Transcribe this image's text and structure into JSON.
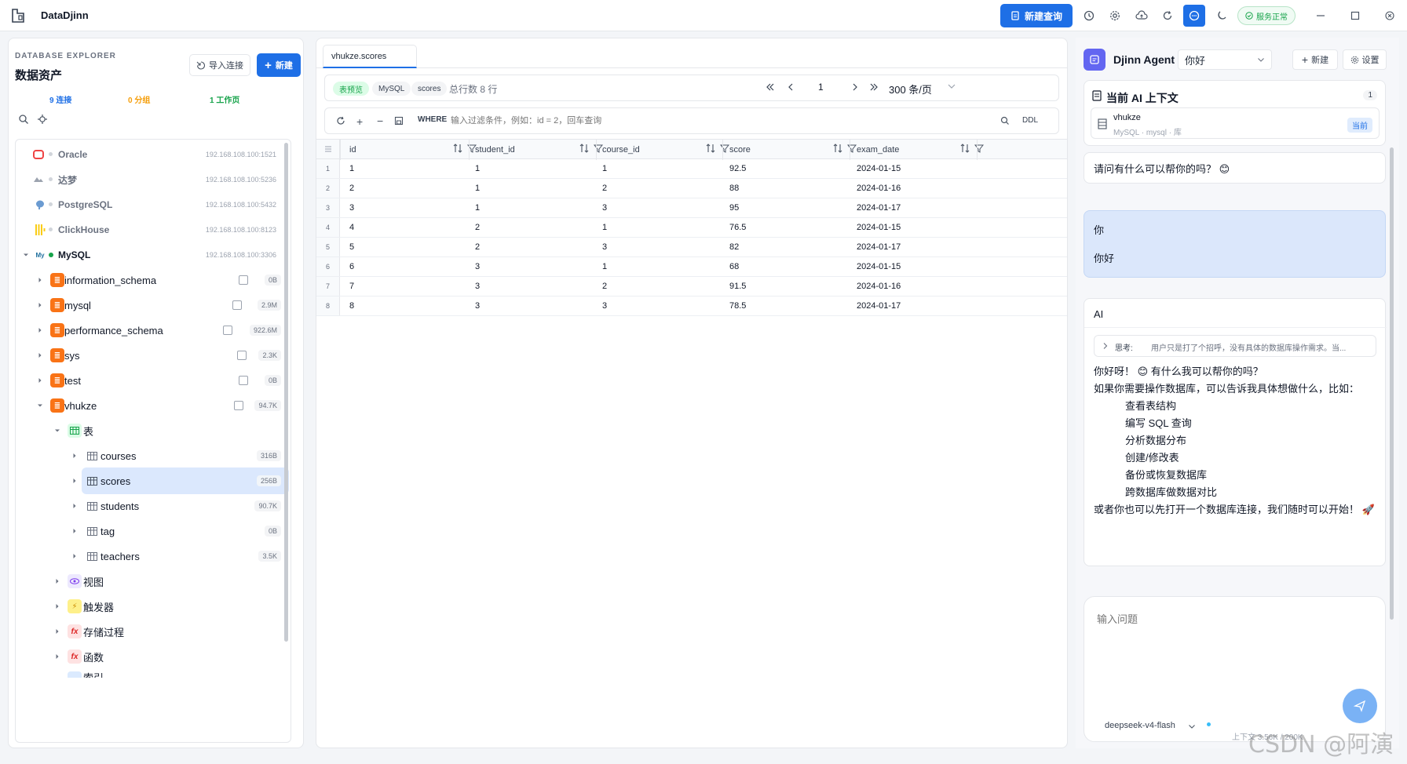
{
  "app": {
    "title": "DataDjinn"
  },
  "titlebar": {
    "new_query": "新建查询",
    "status": "服务正常"
  },
  "colors": {
    "accent": "#1e6fe6",
    "green": "#16a34a",
    "orange": "#f59e0b",
    "purple": "#6366f1"
  },
  "explorer": {
    "subtitle": "DATABASE EXPLORER",
    "title": "数据资产",
    "import_label": "导入连接",
    "new_label": "新建",
    "stats": {
      "connections": "9 连接",
      "groups": "0 分组",
      "workspaces": "1 工作页"
    }
  },
  "tree": {
    "connections": [
      {
        "name": "Oracle",
        "host": "192.168.108.100:1521",
        "icon": "oracle-icon"
      },
      {
        "name": "达梦",
        "host": "192.168.108.100:5236",
        "icon": "dameng-icon"
      },
      {
        "name": "PostgreSQL",
        "host": "192.168.108.100:5432",
        "icon": "postgresql-icon"
      },
      {
        "name": "ClickHouse",
        "host": "192.168.108.100:8123",
        "icon": "clickhouse-icon"
      },
      {
        "name": "MySQL",
        "host": "192.168.108.100:3306",
        "icon": "mysql-icon"
      }
    ],
    "databases": [
      {
        "name": "information_schema",
        "size": "0B"
      },
      {
        "name": "mysql",
        "size": "2.9M"
      },
      {
        "name": "performance_schema",
        "size": "922.6M"
      },
      {
        "name": "sys",
        "size": "2.3K"
      },
      {
        "name": "test",
        "size": "0B"
      },
      {
        "name": "vhukze",
        "size": "94.7K"
      }
    ],
    "tables_group": "表",
    "tables": [
      {
        "name": "courses",
        "size": "316B"
      },
      {
        "name": "scores",
        "size": "256B"
      },
      {
        "name": "students",
        "size": "90.7K"
      },
      {
        "name": "tag",
        "size": "0B"
      },
      {
        "name": "teachers",
        "size": "3.5K"
      }
    ],
    "groups": [
      "视图",
      "触发器",
      "存储过程",
      "函数"
    ],
    "cut_off": "索引"
  },
  "editor": {
    "tab": "vhukze.scores",
    "chips": [
      "表预览",
      "MySQL",
      "scores"
    ],
    "total": "总行数 8 行",
    "page": "1",
    "page_size": "300 条/页",
    "where_label": "WHERE",
    "where_placeholder": "输入过滤条件，例如：id = 2，回车查询",
    "ddl": "DDL",
    "columns": [
      "id",
      "student_id",
      "course_id",
      "score",
      "exam_date"
    ],
    "rows": [
      [
        "1",
        "1",
        "1",
        "92.5",
        "2024-01-15"
      ],
      [
        "2",
        "1",
        "2",
        "88",
        "2024-01-16"
      ],
      [
        "3",
        "1",
        "3",
        "95",
        "2024-01-17"
      ],
      [
        "4",
        "2",
        "1",
        "76.5",
        "2024-01-15"
      ],
      [
        "5",
        "2",
        "3",
        "82",
        "2024-01-17"
      ],
      [
        "6",
        "3",
        "1",
        "68",
        "2024-01-15"
      ],
      [
        "7",
        "3",
        "2",
        "91.5",
        "2024-01-16"
      ],
      [
        "8",
        "3",
        "3",
        "78.5",
        "2024-01-17"
      ]
    ],
    "row_numbers": [
      "1",
      "2",
      "3",
      "4",
      "5",
      "6",
      "7",
      "8"
    ]
  },
  "agent": {
    "name": "Djinn Agent",
    "session": "你好",
    "new_label": "新建",
    "settings_label": "设置",
    "context_title": "当前 AI 上下文",
    "context_count": "1",
    "context_db": "vhukze",
    "context_meta": "MySQL · mysql · 库",
    "context_badge": "当前",
    "greet": "请问有什么可以帮你的吗？ 😊",
    "user_label": "你",
    "user_text": "你好",
    "ai_label": "AI",
    "thinking_label": "思考:",
    "thinking_text": "用户只是打了个招呼，没有具体的数据库操作需求。当...",
    "ai_line1": "你好呀！ 😊 有什么我可以帮你的吗？",
    "ai_line2": "如果你需要操作数据库，可以告诉我具体想做什么，比如：",
    "ai_items": [
      "查看表结构",
      "编写 SQL 查询",
      "分析数据分布",
      "创建/修改表",
      "备份或恢复数据库",
      "跨数据库做数据对比"
    ],
    "ai_line3": "或者你也可以先打开一个数据库连接，我们随时可以开始！ 🚀",
    "input_placeholder": "输入问题",
    "model": "deepseek-v4-flash",
    "context_usage": "上下文 3.56K / 200K"
  },
  "watermark": "CSDN @阿演"
}
